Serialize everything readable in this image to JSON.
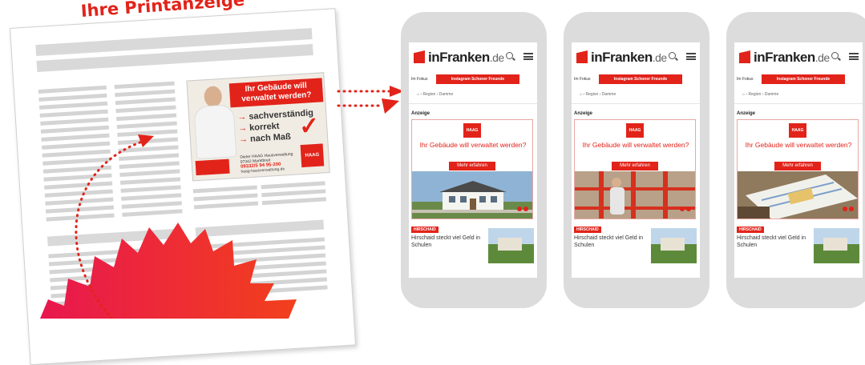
{
  "print": {
    "title": "Ihre Printanzeige",
    "ad": {
      "headline": "Ihr Gebäude will verwaltet werden?",
      "bullets": [
        "sachverständig",
        "korrekt",
        "nach Maß"
      ],
      "contact_name": "Dieter HAAG Hausverwaltung",
      "contact_address": "97342 Marktbreit",
      "phone": "09332/5 94 95-200",
      "web": "haag-hausverwaltung.de",
      "logo_text": "HAAG",
      "arrow_glyph": "→",
      "check_glyph": "✓"
    }
  },
  "phones": [
    {
      "brand": "inFranken",
      "brand_suffix": ".de",
      "nav_first": "Im Fokus",
      "nav_active": "Instagram Schoner Freunde",
      "breadcrumb": "⌂ › Region › Damme",
      "ad_label": "Anzeige",
      "ad_logo": "HAAG",
      "ad_headline": "Ihr Gebäude will verwaltet werden?",
      "cta": "Mehr erfahren",
      "scene": "house",
      "news_tag": "HIRSCHAID",
      "news_title": "Hirschaid steckt viel Geld in Schulen"
    },
    {
      "brand": "inFranken",
      "brand_suffix": ".de",
      "nav_first": "Im Fokus",
      "nav_active": "Instagram Schoner Freunde",
      "breadcrumb": "⌂ › Region › Damme",
      "ad_label": "Anzeige",
      "ad_logo": "HAAG",
      "ad_headline": "Ihr Gebäude will verwaltet werden?",
      "cta": "Mehr erfahren",
      "scene": "scaffold",
      "news_tag": "HIRSCHAID",
      "news_title": "Hirschaid steckt viel Geld in Schulen"
    },
    {
      "brand": "inFranken",
      "brand_suffix": ".de",
      "nav_first": "Im Fokus",
      "nav_active": "Instagram Schoner Freunde",
      "breadcrumb": "⌂ › Region › Damme",
      "ad_label": "Anzeige",
      "ad_logo": "HAAG",
      "ad_headline": "Ihr Gebäude will verwaltet werden?",
      "cta": "Mehr erfahren",
      "scene": "plans",
      "news_tag": "HIRSCHAID",
      "news_title": "Hirschaid steckt viel Geld in Schulen"
    }
  ],
  "colors": {
    "accent": "#e2231a",
    "burst_start": "#e8174f",
    "burst_end": "#f2401c",
    "phone_frame": "#dcdcdc"
  }
}
